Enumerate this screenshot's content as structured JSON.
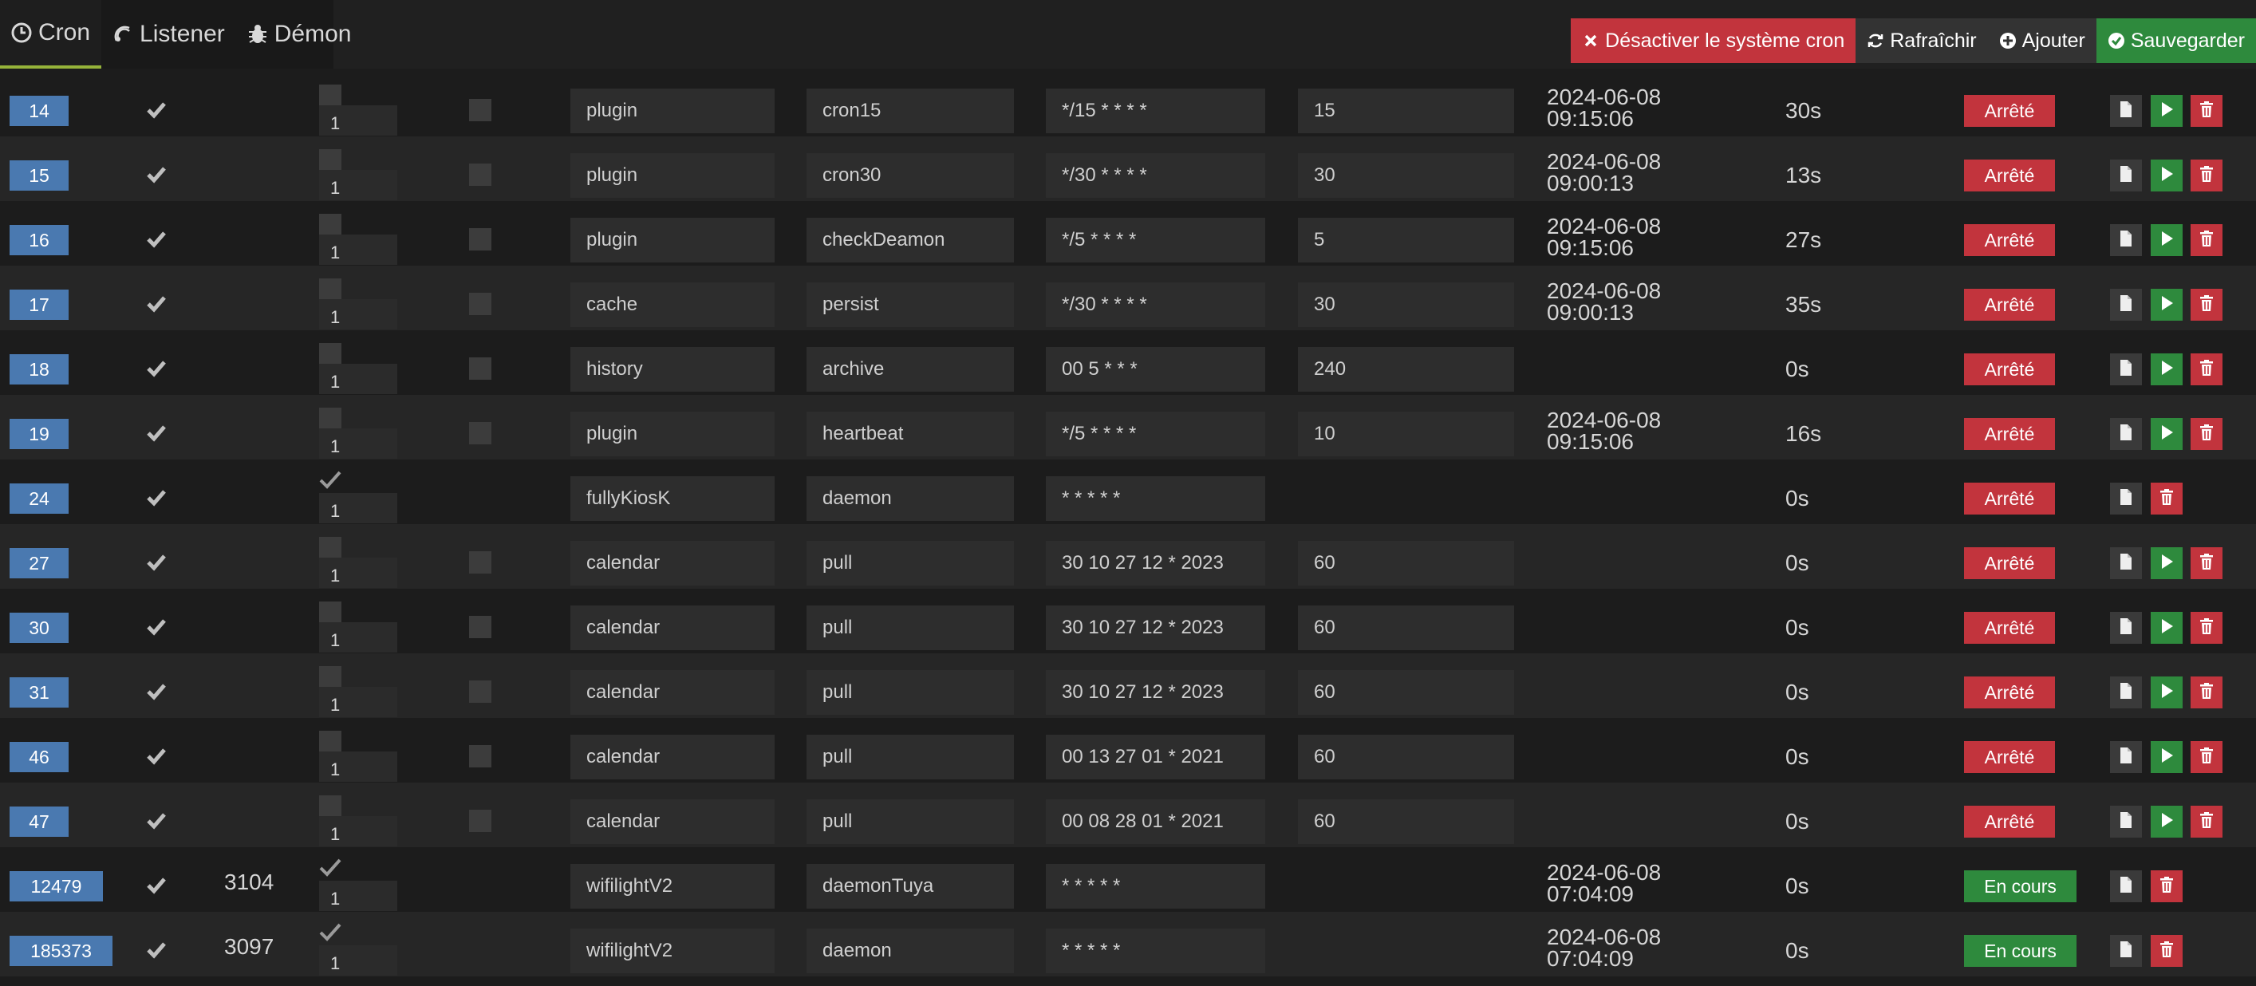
{
  "tabs": [
    {
      "label": "Cron",
      "icon": "clock-icon",
      "active": true
    },
    {
      "label": "Listener",
      "icon": "signal-icon",
      "active": false
    },
    {
      "label": "Démon",
      "icon": "bug-icon",
      "active": false
    }
  ],
  "actions": {
    "disable_label": "Désactiver le système cron",
    "refresh_label": "Rafraîchir",
    "add_label": "Ajouter",
    "save_label": "Sauvegarder"
  },
  "colors": {
    "background": "#1c1c1c",
    "row_alt": "#262626",
    "id_badge": "#4a79b0",
    "danger": "#c2343d",
    "success": "#2e8a3d",
    "tab_accent": "#96b33a"
  },
  "rows": [
    {
      "id": "14",
      "enabled": true,
      "pid": "",
      "deamon": "1",
      "once": false,
      "class": "plugin",
      "function": "cron15",
      "schedule": "*/15 * * * *",
      "timeout": "15",
      "last_run_date": "2024-06-08",
      "last_run_time": "09:15:06",
      "duration": "30s",
      "state": "Arrêté",
      "running": false,
      "runnable": true
    },
    {
      "id": "15",
      "enabled": true,
      "pid": "",
      "deamon": "1",
      "once": false,
      "class": "plugin",
      "function": "cron30",
      "schedule": "*/30 * * * *",
      "timeout": "30",
      "last_run_date": "2024-06-08",
      "last_run_time": "09:00:13",
      "duration": "13s",
      "state": "Arrêté",
      "running": false,
      "runnable": true
    },
    {
      "id": "16",
      "enabled": true,
      "pid": "",
      "deamon": "1",
      "once": false,
      "class": "plugin",
      "function": "checkDeamon",
      "schedule": "*/5 * * * *",
      "timeout": "5",
      "last_run_date": "2024-06-08",
      "last_run_time": "09:15:06",
      "duration": "27s",
      "state": "Arrêté",
      "running": false,
      "runnable": true
    },
    {
      "id": "17",
      "enabled": true,
      "pid": "",
      "deamon": "1",
      "once": false,
      "class": "cache",
      "function": "persist",
      "schedule": "*/30 * * * *",
      "timeout": "30",
      "last_run_date": "2024-06-08",
      "last_run_time": "09:00:13",
      "duration": "35s",
      "state": "Arrêté",
      "running": false,
      "runnable": true
    },
    {
      "id": "18",
      "enabled": true,
      "pid": "",
      "deamon": "1",
      "once": false,
      "class": "history",
      "function": "archive",
      "schedule": "00 5 * * *",
      "timeout": "240",
      "last_run_date": "",
      "last_run_time": "",
      "duration": "0s",
      "state": "Arrêté",
      "running": false,
      "runnable": true
    },
    {
      "id": "19",
      "enabled": true,
      "pid": "",
      "deamon": "1",
      "once": false,
      "class": "plugin",
      "function": "heartbeat",
      "schedule": "*/5 * * * *",
      "timeout": "10",
      "last_run_date": "2024-06-08",
      "last_run_time": "09:15:06",
      "duration": "16s",
      "state": "Arrêté",
      "running": false,
      "runnable": true
    },
    {
      "id": "24",
      "enabled": true,
      "pid": "",
      "deamon": "1",
      "once": null,
      "class": "fullyKiosK",
      "function": "daemon",
      "schedule": "* * * * *",
      "timeout": "",
      "last_run_date": "",
      "last_run_time": "",
      "duration": "0s",
      "state": "Arrêté",
      "running": false,
      "runnable": false
    },
    {
      "id": "27",
      "enabled": true,
      "pid": "",
      "deamon": "1",
      "once": false,
      "class": "calendar",
      "function": "pull",
      "schedule": "30 10 27 12 * 2023",
      "timeout": "60",
      "last_run_date": "",
      "last_run_time": "",
      "duration": "0s",
      "state": "Arrêté",
      "running": false,
      "runnable": true
    },
    {
      "id": "30",
      "enabled": true,
      "pid": "",
      "deamon": "1",
      "once": false,
      "class": "calendar",
      "function": "pull",
      "schedule": "30 10 27 12 * 2023",
      "timeout": "60",
      "last_run_date": "",
      "last_run_time": "",
      "duration": "0s",
      "state": "Arrêté",
      "running": false,
      "runnable": true
    },
    {
      "id": "31",
      "enabled": true,
      "pid": "",
      "deamon": "1",
      "once": false,
      "class": "calendar",
      "function": "pull",
      "schedule": "30 10 27 12 * 2023",
      "timeout": "60",
      "last_run_date": "",
      "last_run_time": "",
      "duration": "0s",
      "state": "Arrêté",
      "running": false,
      "runnable": true
    },
    {
      "id": "46",
      "enabled": true,
      "pid": "",
      "deamon": "1",
      "once": false,
      "class": "calendar",
      "function": "pull",
      "schedule": "00 13 27 01 * 2021",
      "timeout": "60",
      "last_run_date": "",
      "last_run_time": "",
      "duration": "0s",
      "state": "Arrêté",
      "running": false,
      "runnable": true
    },
    {
      "id": "47",
      "enabled": true,
      "pid": "",
      "deamon": "1",
      "once": false,
      "class": "calendar",
      "function": "pull",
      "schedule": "00 08 28 01 * 2021",
      "timeout": "60",
      "last_run_date": "",
      "last_run_time": "",
      "duration": "0s",
      "state": "Arrêté",
      "running": false,
      "runnable": true
    },
    {
      "id": "12479",
      "enabled": true,
      "pid": "3104",
      "deamon": "1",
      "once": null,
      "class": "wifilightV2",
      "function": "daemonTuya",
      "schedule": "* * * * *",
      "timeout": "",
      "last_run_date": "2024-06-08",
      "last_run_time": "07:04:09",
      "duration": "0s",
      "state": "En cours",
      "running": true,
      "runnable": false
    },
    {
      "id": "185373",
      "enabled": true,
      "pid": "3097",
      "deamon": "1",
      "once": null,
      "class": "wifilightV2",
      "function": "daemon",
      "schedule": "* * * * *",
      "timeout": "",
      "last_run_date": "2024-06-08",
      "last_run_time": "07:04:09",
      "duration": "0s",
      "state": "En cours",
      "running": true,
      "runnable": false
    }
  ]
}
